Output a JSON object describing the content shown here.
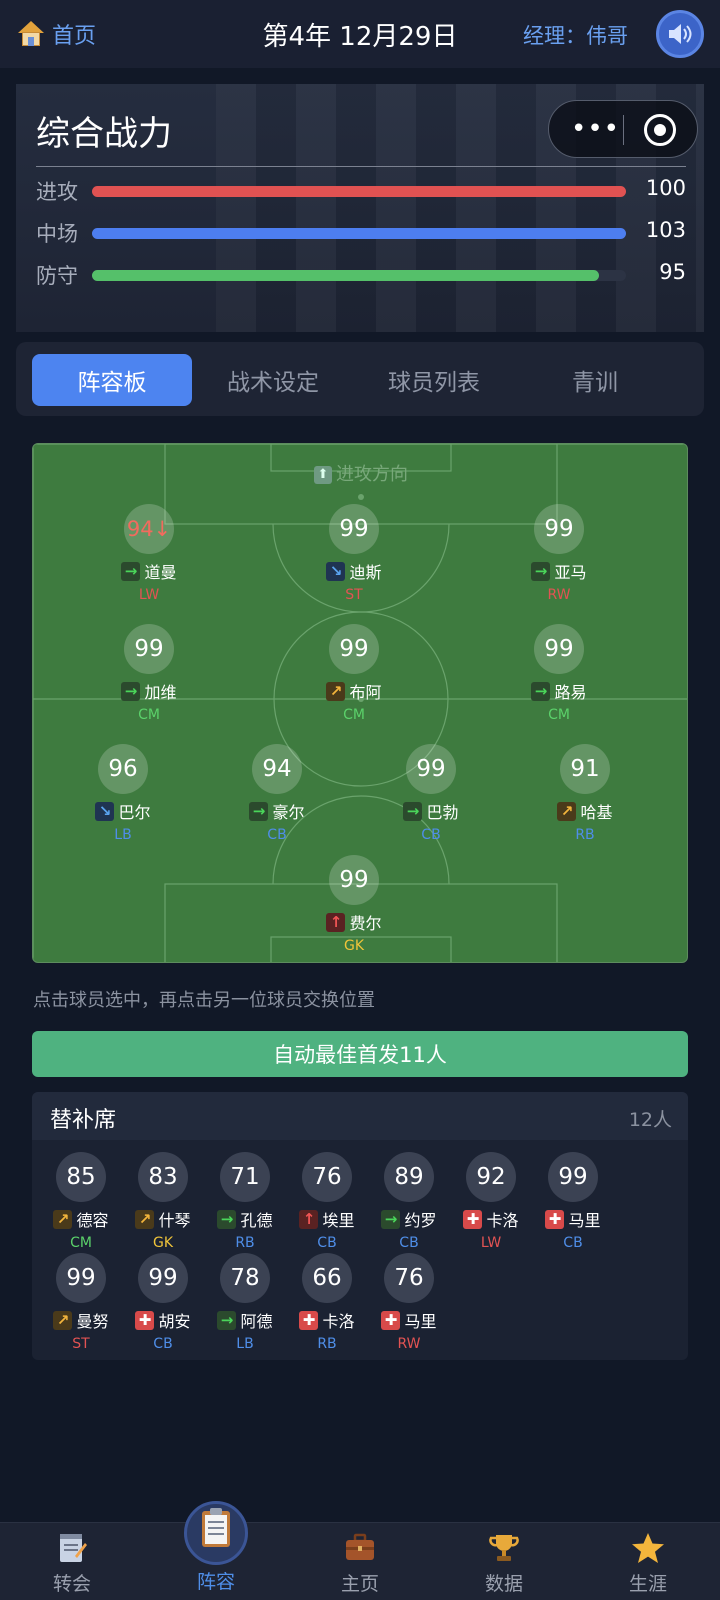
{
  "topbar": {
    "home_label": "首页",
    "date": "第4年 12月29日",
    "manager": "经理：伟哥"
  },
  "power": {
    "title": "综合战力",
    "stats": [
      {
        "label": "进攻",
        "value": "100",
        "fill": 1.0,
        "color": "#e05252"
      },
      {
        "label": "中场",
        "value": "103",
        "fill": 1.0,
        "color": "#4d7ef0"
      },
      {
        "label": "防守",
        "value": "95",
        "fill": 0.95,
        "color": "#55c06a"
      }
    ]
  },
  "tabs": [
    "阵容板",
    "战术设定",
    "球员列表",
    "青训"
  ],
  "pitch": {
    "attack_label": "进攻方向",
    "players": [
      {
        "rating": "94↓",
        "down": true,
        "arrow": "flat",
        "name": "道曼",
        "pos": "LW",
        "pos_color": "red"
      },
      {
        "rating": "99",
        "arrow": "down",
        "name": "迪斯",
        "pos": "ST",
        "pos_color": "red"
      },
      {
        "rating": "99",
        "arrow": "flat",
        "name": "亚马",
        "pos": "RW",
        "pos_color": "red"
      },
      {
        "rating": "99",
        "arrow": "flat",
        "name": "加维",
        "pos": "CM",
        "pos_color": "green"
      },
      {
        "rating": "99",
        "arrow": "up",
        "name": "布阿",
        "pos": "CM",
        "pos_color": "green"
      },
      {
        "rating": "99",
        "arrow": "flat",
        "name": "路易",
        "pos": "CM",
        "pos_color": "green"
      },
      {
        "rating": "96",
        "arrow": "down",
        "name": "巴尔",
        "pos": "LB",
        "pos_color": "blue"
      },
      {
        "rating": "94",
        "arrow": "flat",
        "name": "豪尔",
        "pos": "CB",
        "pos_color": "blue"
      },
      {
        "rating": "99",
        "arrow": "flat",
        "name": "巴勃",
        "pos": "CB",
        "pos_color": "blue"
      },
      {
        "rating": "91",
        "arrow": "up",
        "name": "哈基",
        "pos": "RB",
        "pos_color": "blue"
      },
      {
        "rating": "99",
        "arrow": "bigup",
        "name": "费尔",
        "pos": "GK",
        "pos_color": "yellow"
      }
    ]
  },
  "hint": "点击球员选中，再点击另一位球员交换位置",
  "auto_button": "自动最佳首发11人",
  "bench": {
    "title": "替补席",
    "count": "12人",
    "players": [
      {
        "rating": "85",
        "arrow": "up",
        "name": "德容",
        "pos": "CM",
        "pos_color": "green"
      },
      {
        "rating": "83",
        "arrow": "up",
        "name": "什琴",
        "pos": "GK",
        "pos_color": "yellow"
      },
      {
        "rating": "71",
        "arrow": "flat",
        "name": "孔德",
        "pos": "RB",
        "pos_color": "blue"
      },
      {
        "rating": "76",
        "arrow": "bigup",
        "name": "埃里",
        "pos": "CB",
        "pos_color": "blue"
      },
      {
        "rating": "89",
        "arrow": "flat",
        "name": "约罗",
        "pos": "CB",
        "pos_color": "blue"
      },
      {
        "rating": "92",
        "arrow": "cross",
        "name": "卡洛",
        "pos": "LW",
        "pos_color": "red"
      },
      {
        "rating": "99",
        "arrow": "cross",
        "name": "马里",
        "pos": "CB",
        "pos_color": "blue"
      },
      {
        "rating": "99",
        "arrow": "up",
        "name": "曼努",
        "pos": "ST",
        "pos_color": "red"
      },
      {
        "rating": "99",
        "arrow": "cross",
        "name": "胡安",
        "pos": "CB",
        "pos_color": "blue"
      },
      {
        "rating": "78",
        "arrow": "flat",
        "name": "阿德",
        "pos": "LB",
        "pos_color": "blue"
      },
      {
        "rating": "66",
        "arrow": "cross",
        "name": "卡洛",
        "pos": "RB",
        "pos_color": "blue"
      },
      {
        "rating": "76",
        "arrow": "cross",
        "name": "马里",
        "pos": "RW",
        "pos_color": "red"
      }
    ]
  },
  "nav": [
    {
      "label": "转会",
      "icon": "notepad-icon"
    },
    {
      "label": "阵容",
      "icon": "clipboard-icon",
      "active": true
    },
    {
      "label": "主页",
      "icon": "briefcase-icon"
    },
    {
      "label": "数据",
      "icon": "trophy-icon"
    },
    {
      "label": "生涯",
      "icon": "star-icon"
    }
  ]
}
